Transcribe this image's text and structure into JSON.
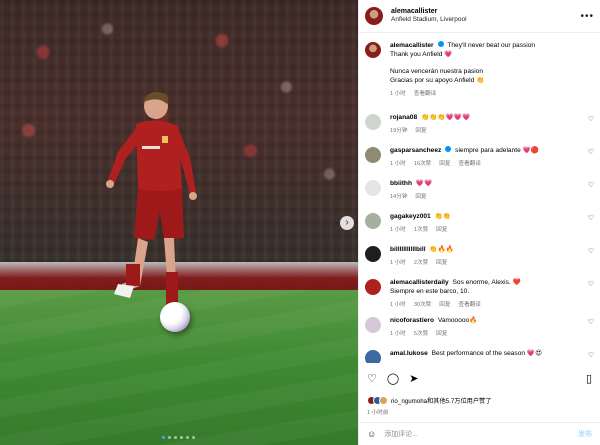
{
  "post": {
    "username": "alemacallister",
    "location": "Anfield Stadium, Liverpool",
    "caption_lines": [
      "They'll never beat our passion",
      "Thank you Anfield 💗",
      "",
      "Nunca vencerán nuestra pasion",
      "Gracias por su apoyo Anfield 👏"
    ],
    "caption_time": "1 小时",
    "caption_translate": "查看翻译"
  },
  "comments": [
    {
      "user": "rojana08",
      "text": "👏👏👏💗💗💗",
      "time": "19分钟",
      "likes": "",
      "reply": "回复",
      "translate": ""
    },
    {
      "user": "gasparsancheez",
      "verified": true,
      "text": "siempre para adelante 💗🔴",
      "time": "1 小时",
      "likes": "16次赞",
      "reply": "回复",
      "translate": "查看翻译"
    },
    {
      "user": "bbiithh",
      "text": "💗💗",
      "time": "14分钟",
      "likes": "",
      "reply": "回复",
      "translate": ""
    },
    {
      "user": "gagakeyz001",
      "text": "👏👏",
      "time": "1 小时",
      "likes": "1次赞",
      "reply": "回复",
      "translate": ""
    },
    {
      "user": "billlllllllllbill",
      "text": "👏🔥🔥",
      "time": "1 小时",
      "likes": "2次赞",
      "reply": "回复",
      "translate": ""
    },
    {
      "user": "alemacallisterdaily",
      "text": "Sos enorme, Alexis. ❤️",
      "text2": "Siempre en este barco, 10.",
      "time": "1 小时",
      "likes": "30次赞",
      "reply": "回复",
      "translate": "查看翻译"
    },
    {
      "user": "nicoforastiero",
      "text": "Vamooooo🔥",
      "time": "1 小时",
      "likes": "5次赞",
      "reply": "回复",
      "translate": ""
    },
    {
      "user": "amal.lukose",
      "text": "Best performance of the season 💗😍",
      "time": "",
      "likes": "",
      "reply": "",
      "translate": ""
    }
  ],
  "likes_text": "rio_ngumoha和其他5.7万位用户赞了",
  "post_time": "1 小时前",
  "add_comment_placeholder": "添加评论...",
  "post_button": "发布",
  "icons": {
    "more": "more-horizontal-icon",
    "heart": "heart-icon",
    "comment": "comment-icon",
    "share": "share-icon",
    "save": "bookmark-icon",
    "emoji": "emoji-icon",
    "next": "chevron-right-icon"
  },
  "colors": {
    "verified": "#0095f6",
    "club_red": "#8a1c1c"
  }
}
